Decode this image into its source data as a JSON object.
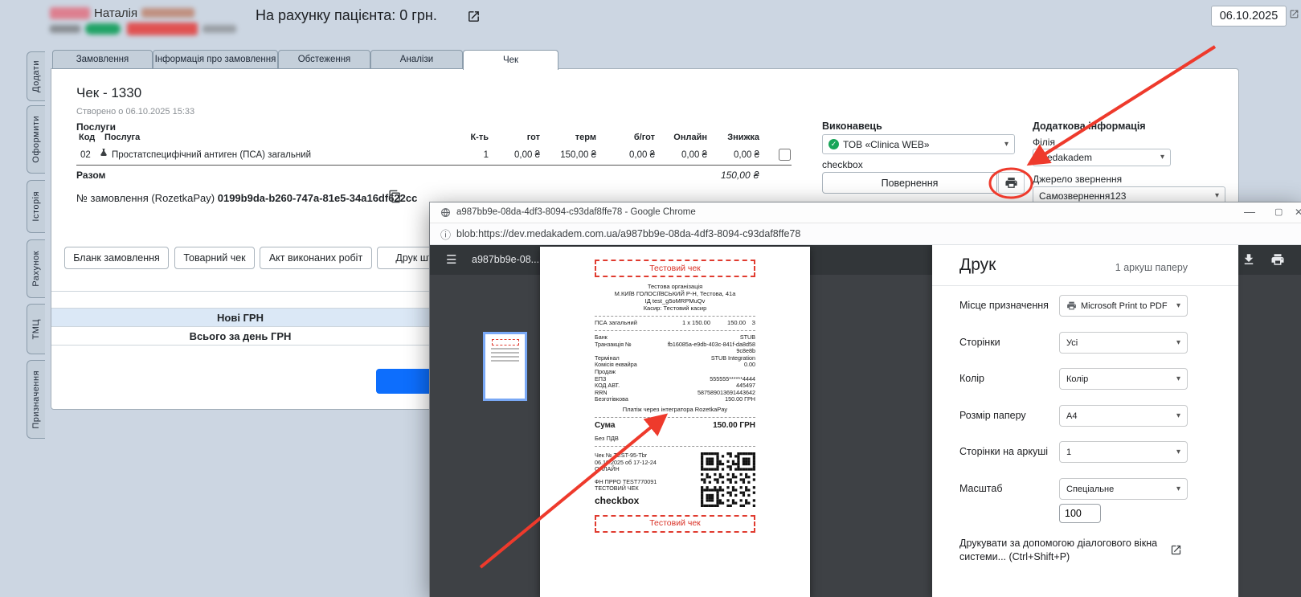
{
  "icons": {
    "hamburger": "☰",
    "info": "ⓘ",
    "minimize": "—",
    "maximize": "▢",
    "close": "✕",
    "caret_down": "▾",
    "check": "✓"
  },
  "app": {
    "patient_name": "Наталія",
    "account_title": "На рахунку пацієнта: 0 грн.",
    "date_value": "06.10.2025",
    "sidebar_items": [
      "Додати",
      "Оформити",
      "Історія",
      "Рахунок",
      "ТМЦ",
      "Призначення"
    ],
    "tabs": [
      "Замовлення",
      "Інформація про замовлення",
      "Обстеження",
      "Аналізи",
      "Чек"
    ],
    "check": {
      "title": "Чек - 1330",
      "created": "Створено о 06.10.2025 15:33",
      "services_title": "Послуги",
      "col_code": "Код",
      "col_service": "Послуга",
      "col_qty": "К-ть",
      "col_cash": "гот",
      "col_term": "терм",
      "col_cashless": "б/гот",
      "col_online": "Онлайн",
      "col_discount": "Знижка",
      "row": {
        "code": "02",
        "name": "Простатспецифічний антиген (ПСА) загальний",
        "qty": "1",
        "cash": "0,00 ₴",
        "term": "150,00 ₴",
        "cashless": "0,00 ₴",
        "online": "0,00 ₴",
        "discount": "0,00 ₴"
      },
      "total_label": "Разом",
      "total_value": "150,00 ₴",
      "order_label": "№ замовлення (RozetkaPay)",
      "order_value": "0199b9da-b260-747a-81e5-34a16df622cc"
    },
    "doc_buttons": [
      "Бланк замовлення",
      "Товарний чек",
      "Акт виконаних робіт",
      "Друк штр"
    ],
    "executor_label": "Виконавець",
    "executor_value": "ТОВ «Clinica WEB»",
    "executor_note": "checkbox",
    "return_button": "Повернення",
    "extra_label": "Додаткова інформація",
    "branch_label": "Філія",
    "branch_value": "medakadem",
    "source_label": "Джерело звернення",
    "source_value": "Самозвернення123",
    "summary_rows": [
      "Нові ГРН",
      "Всього за день ГРН"
    ]
  },
  "chrome": {
    "window_title": "a987bb9e-08da-4df3-8094-c93daf8ffe78 - Google Chrome",
    "url": "blob:https://dev.medakadem.com.ua/a987bb9e-08da-4df3-8094-c93daf8ffe78",
    "pdf_title": "a987bb9e-08...",
    "print": {
      "title": "Друк",
      "sheets": "1 аркуш паперу",
      "fields": [
        {
          "label": "Місце призначення",
          "value": "Microsoft Print to PDF"
        },
        {
          "label": "Сторінки",
          "value": "Усі"
        },
        {
          "label": "Колір",
          "value": "Колір"
        },
        {
          "label": "Розмір паперу",
          "value": "A4"
        },
        {
          "label": "Сторінки на аркуші",
          "value": "1"
        },
        {
          "label": "Масштаб",
          "value": "Спеціальне"
        }
      ],
      "scale_value": "100",
      "system_dialog": "Друкувати за допомогою діалогового вікна системи... (Ctrl+Shift+P)"
    }
  },
  "receipt": {
    "banner": "Тестовий чек",
    "org_lines": [
      "Тестова організація",
      "М.КИЇВ ГОЛОСІЇВСЬКИЙ Р-Н, Тестова, 41а",
      "ІД test_g5oMRPMuQv",
      "Касир: Тестовий касир"
    ],
    "item": {
      "name": "ПСА загальний",
      "qty": "1 х 150.00",
      "total": "150.00",
      "tax": "З"
    },
    "payment_rows": [
      [
        "Банк",
        "STUB"
      ],
      [
        "Транзакція №",
        "fb16085a-e9db-403c-841f-da8d589c8e8b"
      ],
      [
        "Термінал",
        "STUB Integration"
      ],
      [
        "Комісія еквайра",
        "0.00"
      ],
      [
        "Продаж",
        ""
      ],
      [
        "ЕПЗ",
        "555555******4444"
      ],
      [
        "КОД АВТ.",
        "445497"
      ],
      [
        "RRN",
        "587589013691443642"
      ],
      [
        "Безготівкова",
        "150.00 ГРН"
      ]
    ],
    "integrator": "Платіж через інтегратора RozetkaPay",
    "sum_label": "Сума",
    "sum_value": "150.00 ГРН",
    "vat": "Без ПДВ",
    "footer_lines": [
      "Чек № TEST-95-Tbr",
      "06.10.2025 об 17-12-24",
      "ОНЛАЙН"
    ],
    "fiscal_lines": [
      "ФН ПРРО TEST770091",
      "ТЕСТОВИЙ ЧЕК"
    ],
    "logo": "checkbox"
  }
}
